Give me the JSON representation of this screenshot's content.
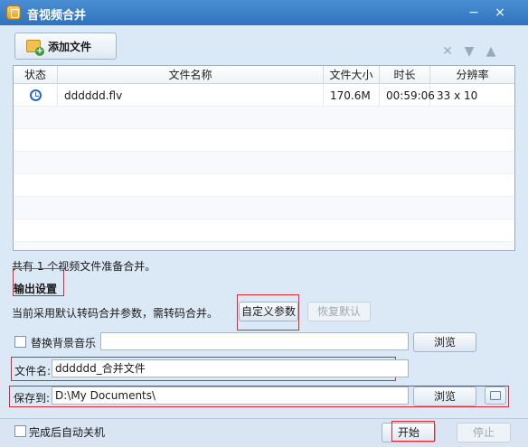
{
  "window": {
    "title": "音视频合并",
    "minimize": "−",
    "close": "×"
  },
  "toolbar": {
    "add_file": "添加文件",
    "delete_symbol": "✕",
    "down_symbol": "▼",
    "up_symbol": "▲"
  },
  "table": {
    "headers": [
      "状态",
      "文件名称",
      "文件大小",
      "时长",
      "分辨率"
    ],
    "rows": [
      {
        "status_icon": "clock-icon",
        "filename": "dddddd.flv",
        "size": "170.6M",
        "duration": "00:59:06",
        "resolution": "33 x 10"
      }
    ]
  },
  "summary": "共有 1 个视频文件准备合并。",
  "output": {
    "heading": "输出设置",
    "description": "当前采用默认转码合并参数，需转码合并。",
    "custom_button": "自定义参数",
    "restore_button": "恢复默认",
    "replace_music_label": "替换背景音乐",
    "replace_music_checked": false,
    "browse_label": "浏览",
    "filename_label": "文件名:",
    "filename_value": "dddddd_合并文件",
    "save_label": "保存到:",
    "save_path": "D:\\My Documents\\",
    "browse_label_2": "浏览"
  },
  "footer": {
    "shutdown_label": "完成后自动关机",
    "shutdown_checked": false,
    "start_button": "开始",
    "stop_button": "停止"
  },
  "colors": {
    "titlebar": "#3a82cf",
    "background": "#dbe8f5",
    "red_annotation": "#e0282f"
  }
}
